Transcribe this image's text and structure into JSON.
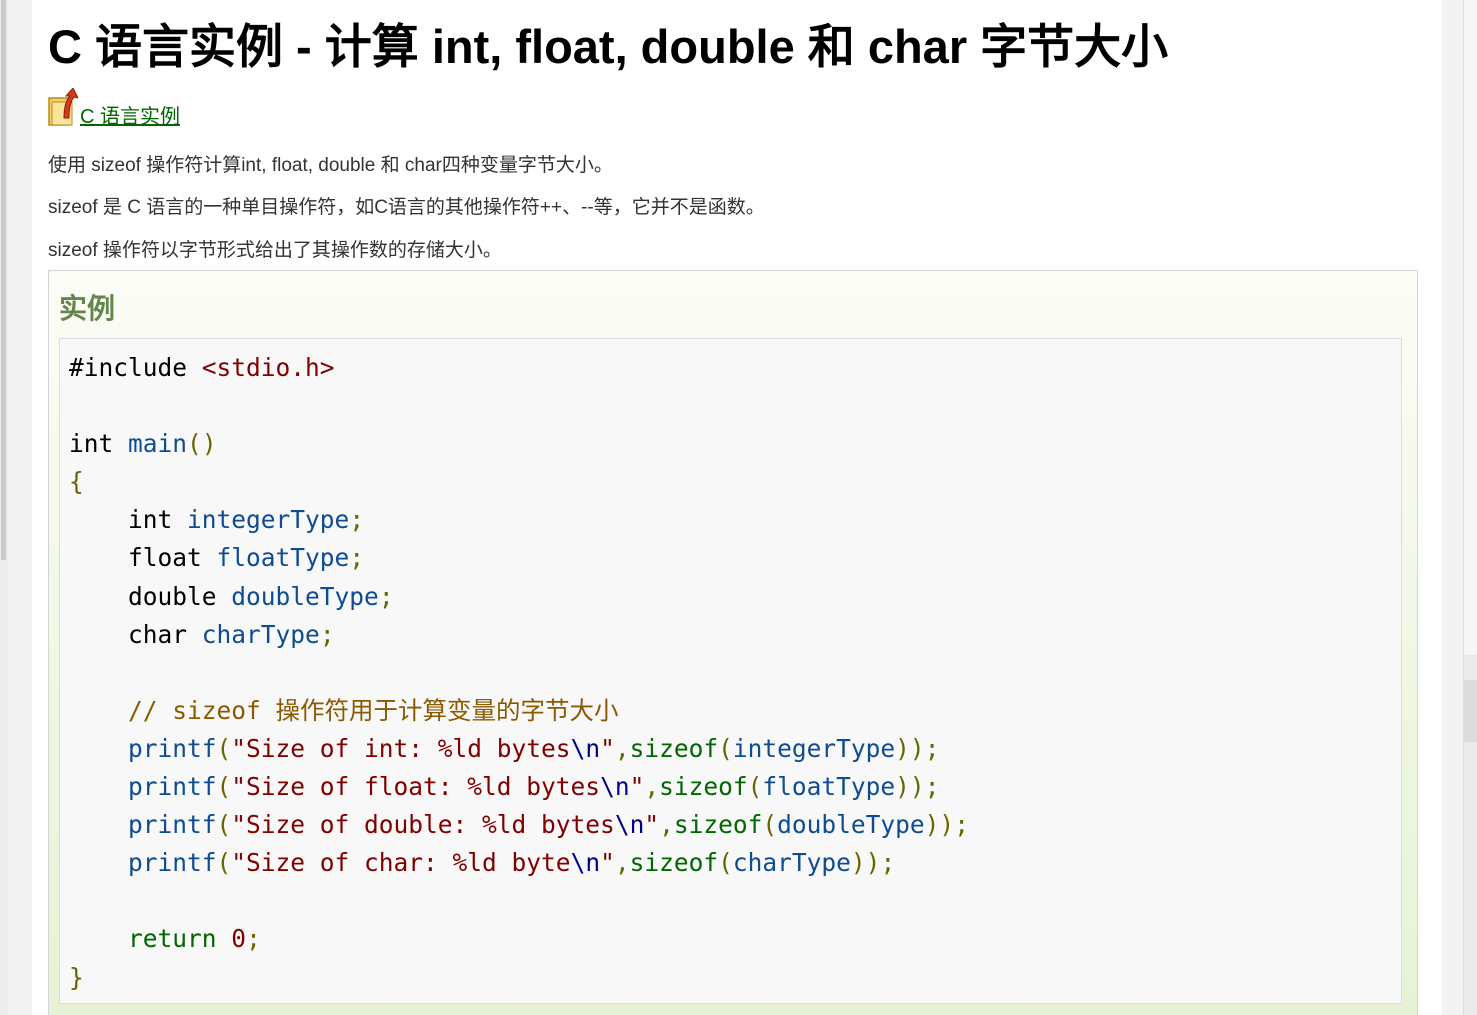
{
  "title": "C 语言实例 - 计算 int, float, double 和 char 字节大小",
  "back_link": {
    "icon": "up-arrow-folder-icon",
    "label": "C 语言实例"
  },
  "paragraphs": [
    "使用 sizeof 操作符计算int, float, double 和 char四种变量字节大小。",
    "sizeof 是 C 语言的一种单目操作符，如C语言的其他操作符++、--等，它并不是函数。",
    "sizeof 操作符以字节形式给出了其操作数的存储大小。"
  ],
  "example": {
    "heading": "实例",
    "code_lines": [
      "#include <stdio.h>",
      "",
      "int main()",
      "{",
      "    int integerType;",
      "    float floatType;",
      "    double doubleType;",
      "    char charType;",
      "",
      "    // sizeof 操作符用于计算变量的字节大小",
      "    printf(\"Size of int: %ld bytes\\n\",sizeof(integerType));",
      "    printf(\"Size of float: %ld bytes\\n\",sizeof(floatType));",
      "    printf(\"Size of double: %ld bytes\\n\",sizeof(doubleType));",
      "    printf(\"Size of char: %ld byte\\n\",sizeof(charType));",
      "",
      "    return 0;",
      "}"
    ]
  },
  "colors": {
    "link": "#006600",
    "example_heading": "#64854c",
    "code_background": "#f8f8f8"
  }
}
